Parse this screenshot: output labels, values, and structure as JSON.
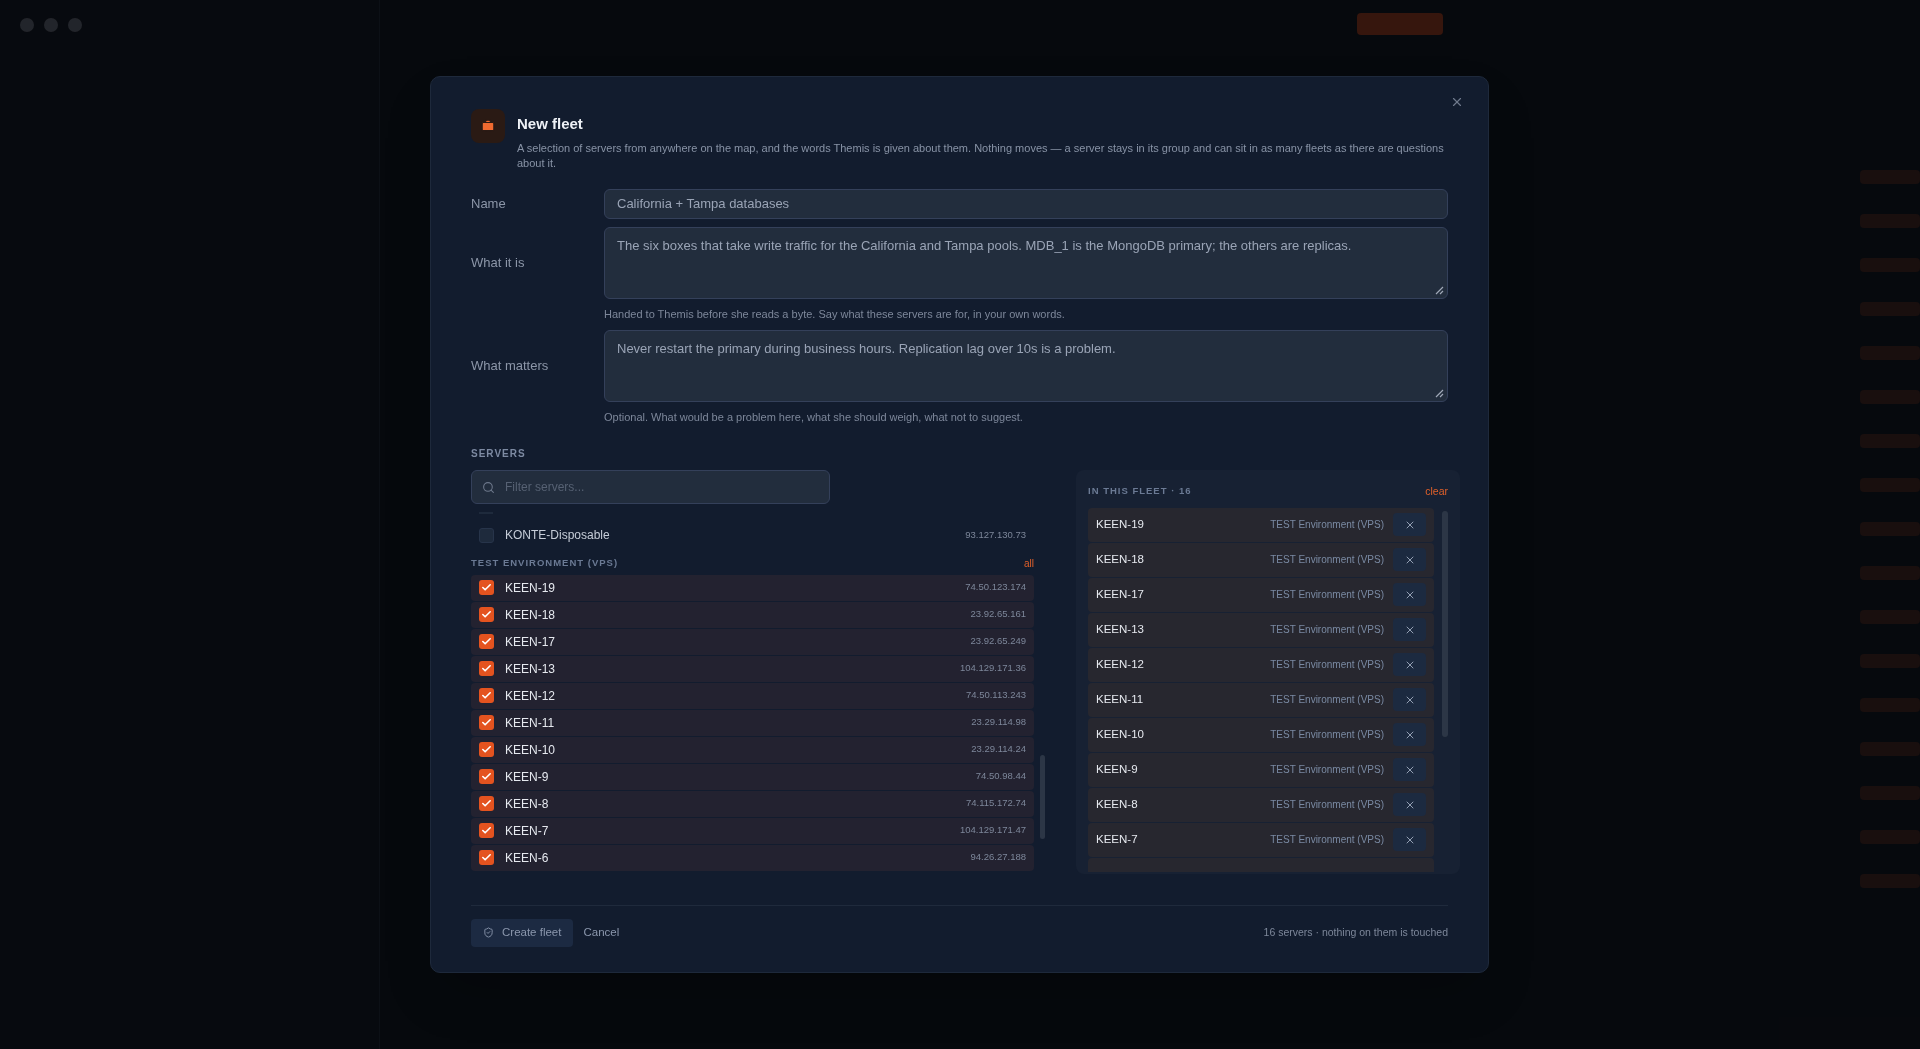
{
  "dialog": {
    "title": "New fleet",
    "description": "A selection of servers from anywhere on the map, and the words Themis is given about them. Nothing moves — a server stays in its group and can sit in as many fleets as there are questions about it.",
    "fields": [
      {
        "kind": "input",
        "label": "Name",
        "value": "California + Tampa databases"
      },
      {
        "kind": "textarea",
        "label": "What it is",
        "value": "The six boxes that take write traffic for the California and Tampa pools. MDB_1 is the MongoDB primary; the others are replicas.",
        "hint": "Handed to Themis before she reads a byte. Say what these servers are for, in your own words."
      },
      {
        "kind": "textarea",
        "label": "What matters",
        "value": "Never restart the primary during business hours. Replication lag over 10s is a problem.",
        "hint": "Optional. What would be a problem here, what she should weigh, what not to suggest."
      }
    ],
    "servers": {
      "heading": "SERVERS",
      "filter": {
        "placeholder": "Filter servers..."
      },
      "ungrouped": [
        {
          "name": "KONTE-Disposable",
          "ip": "93.127.130.73",
          "checked": false
        }
      ],
      "groups": [
        {
          "title": "TEST ENVIRONMENT (VPS)",
          "action": "all",
          "rows": [
            {
              "name": "KEEN-19",
              "ip": "74.50.123.174",
              "checked": true
            },
            {
              "name": "KEEN-18",
              "ip": "23.92.65.161",
              "checked": true
            },
            {
              "name": "KEEN-17",
              "ip": "23.92.65.249",
              "checked": true
            },
            {
              "name": "KEEN-13",
              "ip": "104.129.171.36",
              "checked": true
            },
            {
              "name": "KEEN-12",
              "ip": "74.50.113.243",
              "checked": true
            },
            {
              "name": "KEEN-11",
              "ip": "23.29.114.98",
              "checked": true
            },
            {
              "name": "KEEN-10",
              "ip": "23.29.114.24",
              "checked": true
            },
            {
              "name": "KEEN-9",
              "ip": "74.50.98.44",
              "checked": true
            },
            {
              "name": "KEEN-8",
              "ip": "74.115.172.74",
              "checked": true
            },
            {
              "name": "KEEN-7",
              "ip": "104.129.171.47",
              "checked": true
            },
            {
              "name": "KEEN-6",
              "ip": "94.26.27.188",
              "checked": true
            }
          ]
        }
      ]
    },
    "fleet": {
      "heading": "IN THIS FLEET · 16",
      "action": "clear",
      "rows": [
        {
          "name": "KEEN-19",
          "group": "TEST Environment (VPS)"
        },
        {
          "name": "KEEN-18",
          "group": "TEST Environment (VPS)"
        },
        {
          "name": "KEEN-17",
          "group": "TEST Environment (VPS)"
        },
        {
          "name": "KEEN-13",
          "group": "TEST Environment (VPS)"
        },
        {
          "name": "KEEN-12",
          "group": "TEST Environment (VPS)"
        },
        {
          "name": "KEEN-11",
          "group": "TEST Environment (VPS)"
        },
        {
          "name": "KEEN-10",
          "group": "TEST Environment (VPS)"
        },
        {
          "name": "KEEN-9",
          "group": "TEST Environment (VPS)"
        },
        {
          "name": "KEEN-8",
          "group": "TEST Environment (VPS)"
        },
        {
          "name": "KEEN-7",
          "group": "TEST Environment (VPS)"
        }
      ]
    },
    "footer": {
      "primary": "Create fleet",
      "secondary": "Cancel",
      "note": "16 servers · nothing on them is touched"
    }
  }
}
